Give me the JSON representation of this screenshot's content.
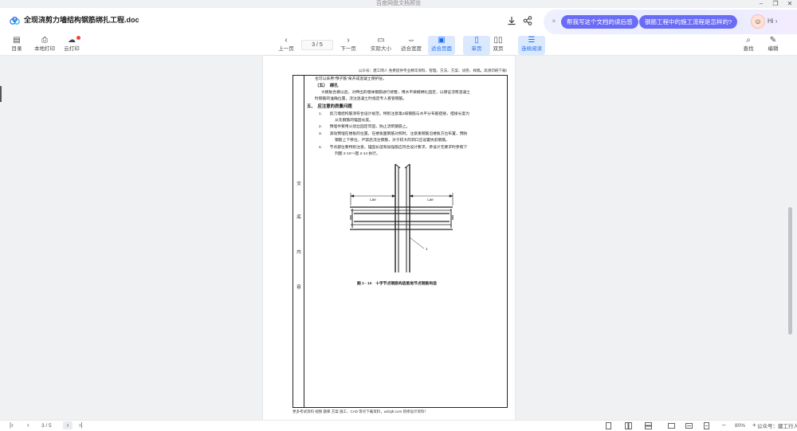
{
  "window": {
    "title": "百度网盘文档预览",
    "minimize": "–",
    "restore": "❐",
    "close": "✕"
  },
  "header": {
    "doc_title": "全现浇剪力墙结构钢筋绑扎工程.doc",
    "download_icon": "download-icon",
    "share_icon": "share-icon",
    "ai_close": "×",
    "ai_suggestions": [
      "帮我写这个文档的读后感",
      "钢筋工程中的施工流程是怎样的?"
    ],
    "ai_greeting": "Hi ›"
  },
  "toolbar": {
    "left": [
      {
        "icon": "▤",
        "label": "目录"
      },
      {
        "icon": "⎙",
        "label": "本地打印"
      },
      {
        "icon": "☁",
        "label": "云打印"
      }
    ],
    "prev_label": "上一页",
    "prev_icon": "‹",
    "page_input": "3 / 5",
    "next_label": "下一页",
    "next_icon": "›",
    "view_modes": [
      {
        "icon": "▭",
        "label": "实际大小",
        "active": false
      },
      {
        "icon": "⇔",
        "label": "适合宽度",
        "active": false
      },
      {
        "icon": "▣",
        "label": "适合页面",
        "active": true
      },
      {
        "icon": "▯",
        "label": "单页",
        "active": true
      },
      {
        "icon": "▯▯",
        "label": "双页",
        "active": false
      },
      {
        "icon": "☰",
        "label": "连续阅读",
        "active": true
      }
    ],
    "right": [
      {
        "icon": "⌕",
        "label": "查找"
      },
      {
        "icon": "✎",
        "label": "编辑"
      }
    ]
  },
  "document": {
    "header_note": "公众号：建工网人 免费提供专业精华资料、管理、方法、方案、试卷、样稿。高清印刷下载!",
    "lines": [
      {
        "text": "也可以采用\"预子筋\"来开成混凝土保护层。",
        "bold": false
      },
      {
        "text": "（五）　绑扎",
        "bold": true
      },
      {
        "text": "大模板合模以后，对伸出的墙体钢筋进行修整，用水平梁模绑扎固定，以保证浇筑混凝土",
        "bold": false
      },
      {
        "text": "时钢筋的准确位置，浇注混凝土时指定专人看管钢筋。",
        "bold": false
      },
      {
        "text": "五、　应注意的质量问题",
        "bold": true
      },
      {
        "text": "1.　　剪刀墙结构筋须符合设计规范，特别注意第2排钢筋与水平分布筋搭接，搭接长度为",
        "bold": false
      },
      {
        "text": "从先钢筋的锚固长度。",
        "bold": false
      },
      {
        "text": "2.　　预埋件要用火烧丝固定牢固，防止浇筑钢筋上。",
        "bold": false
      },
      {
        "text": "3.　　滚动预埋在楼板的位置，在楼板面钢筋对照时，注意重钢筋沿楼板方位布置，预防",
        "bold": false
      },
      {
        "text": "钢筋上下移位，严禁后浇注钢筋，对于较大的洞口应设置抗剪钢筋。",
        "bold": false
      },
      {
        "text": "4.　　节点部位要特别注意，锚固长度和加强筋应符合设计要求，参设计无要求时参照下",
        "bold": false
      },
      {
        "text": "列图 2-10～图 2-14 执行。",
        "bold": false
      }
    ],
    "side_chars": [
      "交",
      "底",
      "内",
      "容"
    ],
    "figure_caption": "图 2 - 10　十字节点钢筋构造筋角节点钢筋构造",
    "fig_labels": {
      "left": "Lae",
      "right": "Lae",
      "mark": "1"
    },
    "footer": "更多考试资料 视频 题库 方案 施工、CAD 等尽下载资料，wdzjdt.com 装修设计资料！"
  },
  "statusbar": {
    "first_icon": "|‹",
    "prev_icon": "‹",
    "page": "3 / 5",
    "next_icon": "›",
    "last_icon": "›|",
    "zoom": "80%",
    "zoom_out": "–",
    "zoom_in": "+",
    "watermark": "公众号：建工行人"
  }
}
